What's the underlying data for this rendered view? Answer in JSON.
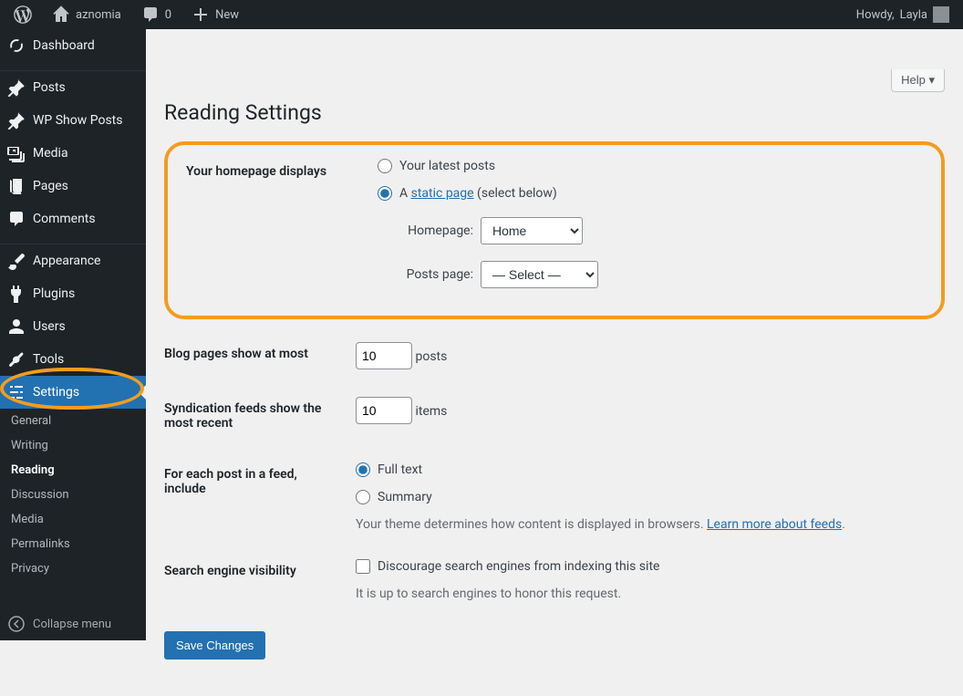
{
  "adminbar": {
    "site_name": "aznomia",
    "comments_count": "0",
    "new_label": "New",
    "howdy_prefix": "Howdy, ",
    "user_name": "Layla"
  },
  "sidebar": {
    "items": [
      {
        "label": "Dashboard"
      },
      {
        "label": "Posts"
      },
      {
        "label": "WP Show Posts"
      },
      {
        "label": "Media"
      },
      {
        "label": "Pages"
      },
      {
        "label": "Comments"
      },
      {
        "label": "Appearance"
      },
      {
        "label": "Plugins"
      },
      {
        "label": "Users"
      },
      {
        "label": "Tools"
      },
      {
        "label": "Settings"
      }
    ],
    "submenu": [
      {
        "label": "General"
      },
      {
        "label": "Writing"
      },
      {
        "label": "Reading"
      },
      {
        "label": "Discussion"
      },
      {
        "label": "Media"
      },
      {
        "label": "Permalinks"
      },
      {
        "label": "Privacy"
      }
    ],
    "collapse_label": "Collapse menu"
  },
  "page": {
    "help_label": "Help",
    "title": "Reading Settings",
    "rows": {
      "homepage_displays": {
        "label": "Your homepage displays",
        "option_latest": "Your latest posts",
        "option_static_prefix": "A ",
        "option_static_link": "static page",
        "option_static_suffix": " (select below)",
        "homepage_label": "Homepage:",
        "homepage_value": "Home",
        "postspage_label": "Posts page:",
        "postspage_value": "— Select —"
      },
      "blog_pages": {
        "label": "Blog pages show at most",
        "value": "10",
        "unit": "posts"
      },
      "syndication": {
        "label": "Syndication feeds show the most recent",
        "value": "10",
        "unit": "items"
      },
      "feed_include": {
        "label": "For each post in a feed, include",
        "option_full": "Full text",
        "option_summary": "Summary",
        "description_prefix": "Your theme determines how content is displayed in browsers. ",
        "description_link": "Learn more about feeds",
        "description_suffix": "."
      },
      "search_engine": {
        "label": "Search engine visibility",
        "checkbox_label": "Discourage search engines from indexing this site",
        "description": "It is up to search engines to honor this request."
      }
    },
    "save_label": "Save Changes"
  }
}
